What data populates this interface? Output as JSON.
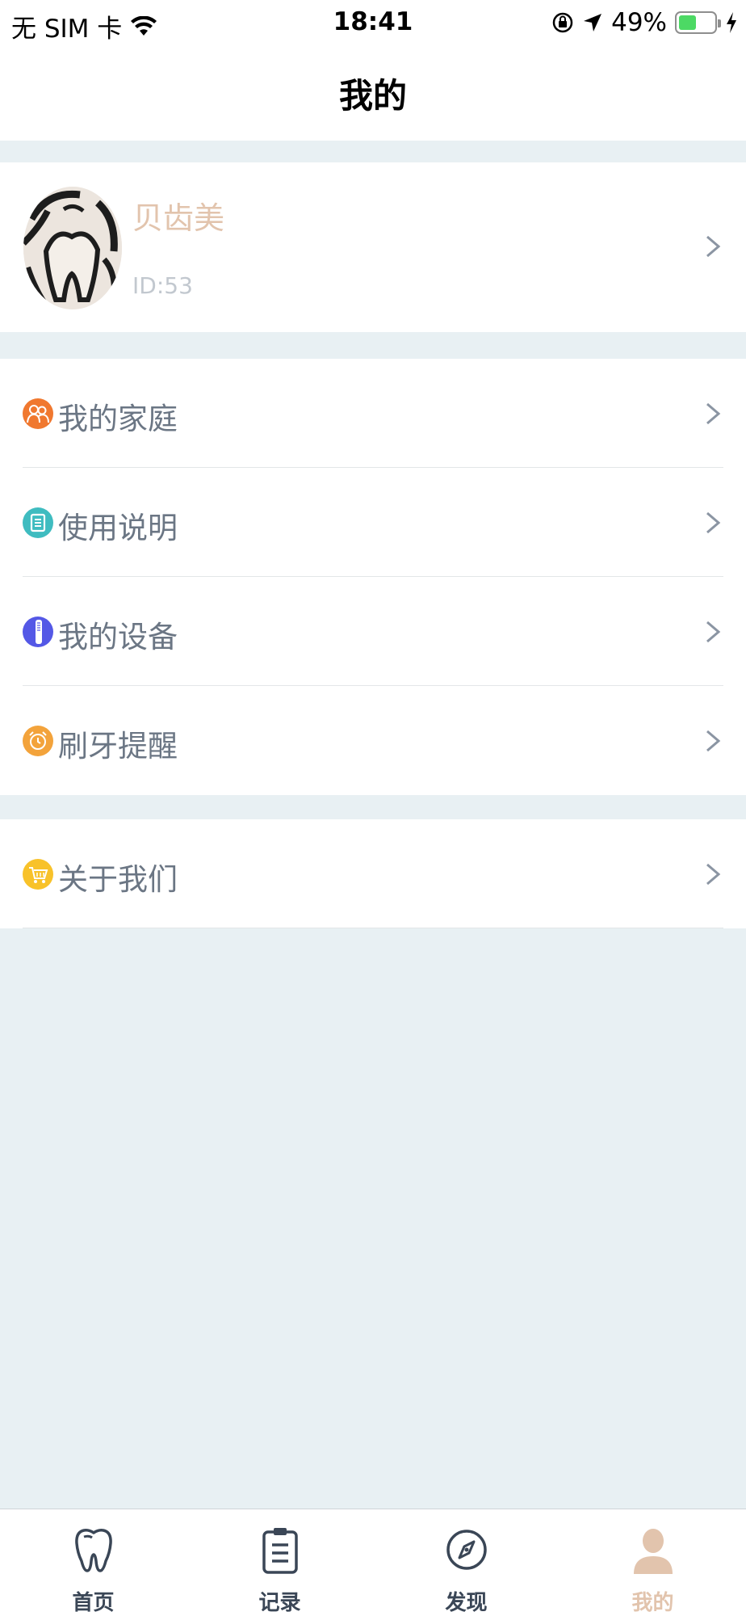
{
  "status_bar": {
    "carrier": "无 SIM 卡",
    "time": "18:41",
    "battery_percent": "49%",
    "battery_level": 0.49
  },
  "nav": {
    "title": "我的"
  },
  "profile": {
    "name": "贝齿美",
    "id_text": "ID:53"
  },
  "menu": {
    "group1": [
      {
        "label": "我的家庭",
        "icon": "family-icon",
        "color": "#f0782f"
      },
      {
        "label": "使用说明",
        "icon": "document-icon",
        "color": "#3fbcc0"
      },
      {
        "label": "我的设备",
        "icon": "toothbrush-icon",
        "color": "#5458e6"
      },
      {
        "label": "刷牙提醒",
        "icon": "alarm-clock-icon",
        "color": "#f3a33b"
      }
    ],
    "group2": [
      {
        "label": "关于我们",
        "icon": "shopping-cart-icon",
        "color": "#f8c22a"
      }
    ]
  },
  "tab_bar": {
    "tabs": [
      {
        "label": "首页",
        "icon": "tooth-icon",
        "active": false
      },
      {
        "label": "记录",
        "icon": "clipboard-icon",
        "active": false
      },
      {
        "label": "发现",
        "icon": "compass-icon",
        "active": false
      },
      {
        "label": "我的",
        "icon": "person-icon",
        "active": true
      }
    ],
    "active_color": "#e2c4ad",
    "inactive_color": "#3a4656"
  }
}
